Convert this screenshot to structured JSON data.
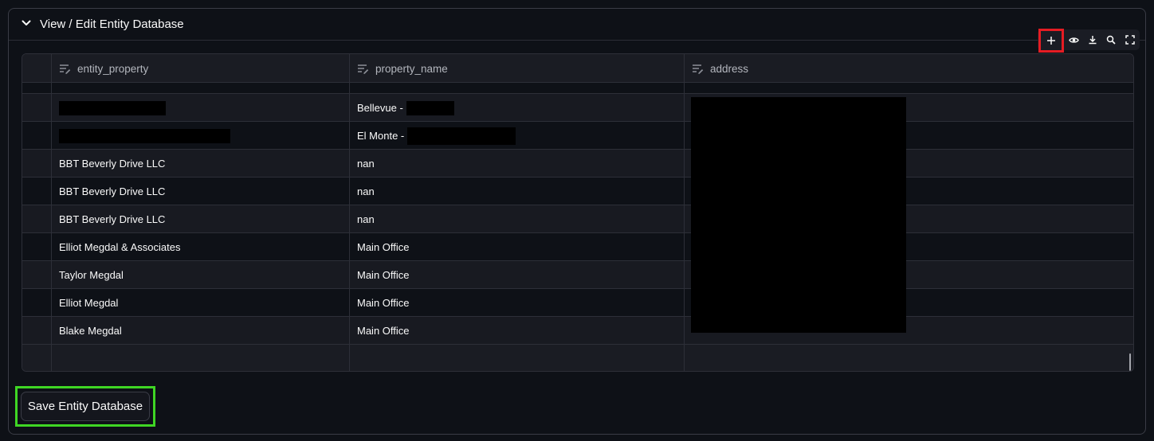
{
  "expander": {
    "title": "View / Edit Entity Database"
  },
  "toolbar": {
    "add_icon": "plus-icon",
    "visibility_icon": "eye-icon",
    "download_icon": "download-icon",
    "search_icon": "search-icon",
    "fullscreen_icon": "fullscreen-icon"
  },
  "table": {
    "columns": [
      "entity_property",
      "property_name",
      "address"
    ],
    "rows": [
      {
        "entity_property": "",
        "property_name": "Bellevue -",
        "address": ""
      },
      {
        "entity_property": "",
        "property_name": "El Monte -",
        "address": ""
      },
      {
        "entity_property": "BBT Beverly Drive LLC",
        "property_name": "nan",
        "address": ""
      },
      {
        "entity_property": "BBT Beverly Drive LLC",
        "property_name": "nan",
        "address": ""
      },
      {
        "entity_property": "BBT Beverly Drive LLC",
        "property_name": "nan",
        "address": ""
      },
      {
        "entity_property": "Elliot Megdal & Associates",
        "property_name": "Main Office",
        "address": ""
      },
      {
        "entity_property": "Taylor Megdal",
        "property_name": "Main Office",
        "address": ""
      },
      {
        "entity_property": "Elliot Megdal",
        "property_name": "Main Office",
        "address": ""
      },
      {
        "entity_property": "Blake Megdal",
        "property_name": "Main Office",
        "address": ""
      }
    ]
  },
  "save_button": {
    "label": "Save Entity Database"
  },
  "colors": {
    "highlight_red": "#e51c23",
    "highlight_green": "#3fd624",
    "background": "#0e1117"
  }
}
